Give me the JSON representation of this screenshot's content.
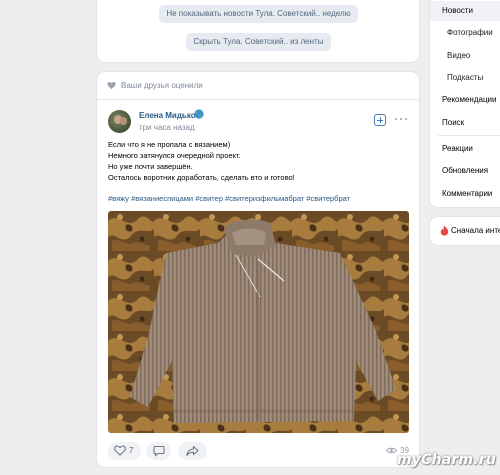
{
  "news_actions": {
    "hide_week_label": "Не показывать новости Тула. Советский.. неделю",
    "hide_feed_label": "Скрыть Тула. Советский.. из ленты"
  },
  "post": {
    "friends_liked": "Ваши друзья оценили",
    "author": "Елена Мидько",
    "time": "три часа назад",
    "text_lines": [
      "Если что я не пропала с вязанием)",
      "Немного затянулся очередной проект.",
      "Но уже почти завершён.",
      "Осталось воротник доработать, сделать вто и готово!"
    ],
    "hashtags": "#вяжу #вязаниеспицами #свитер #свитеризфильмабрат #свитербрат",
    "photo_icon": "knitted-sweater-photo",
    "likes": "7",
    "views": "39"
  },
  "sidebar": {
    "items": [
      {
        "label": "Новости"
      },
      {
        "label": "Фотографии"
      },
      {
        "label": "Видео"
      },
      {
        "label": "Подкасты"
      },
      {
        "label": "Рекомендации"
      },
      {
        "label": "Поиск"
      },
      {
        "label": "Реакции"
      },
      {
        "label": "Обновления"
      },
      {
        "label": "Комментарии"
      }
    ],
    "first_interesting": "Сначала интер"
  },
  "watermark": "myCharm.ru",
  "colors": {
    "background": "#edeef0",
    "link": "#2a5885",
    "button_bg": "#e5ebf1",
    "secondary_text": "#818c99"
  }
}
